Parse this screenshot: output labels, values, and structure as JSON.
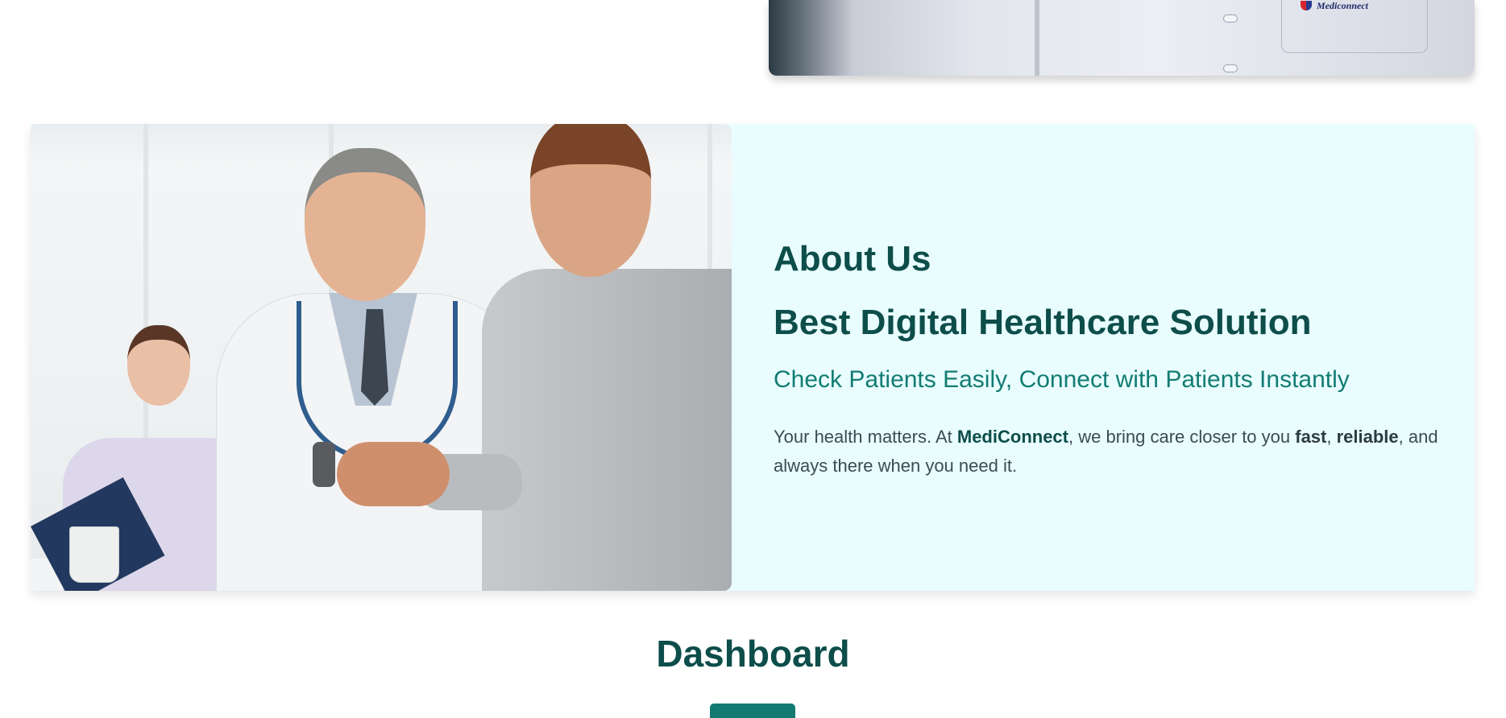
{
  "top_card": {
    "logo_text": "Mediconnect"
  },
  "about": {
    "heading": "About Us",
    "title": "Best Digital Healthcare Solution",
    "subtitle": "Check Patients Easily, Connect with Patients Instantly",
    "description": {
      "part1": "Your health matters. At ",
      "brand": "MediConnect",
      "part2": ", we bring care closer to you ",
      "bold1": "fast",
      "sep": ", ",
      "bold2": "reliable",
      "part3": ", and always there when you need it."
    }
  },
  "dashboard": {
    "title": "Dashboard"
  },
  "colors": {
    "primary_dark": "#0d4d4a",
    "accent": "#127c73",
    "about_bg": "#e9fdfe"
  }
}
